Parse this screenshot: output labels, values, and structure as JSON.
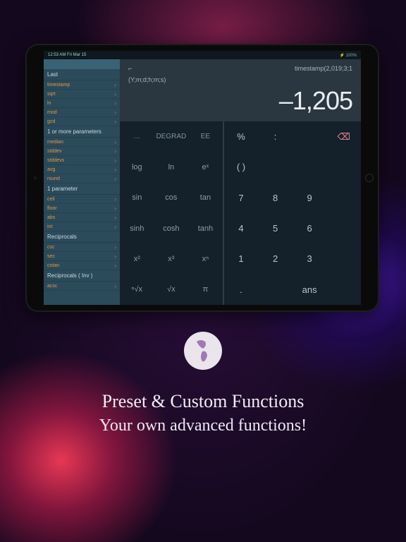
{
  "status": {
    "left": "12:53 AM  Fri Mar 15",
    "right": "⚡ 100%"
  },
  "sidebar": {
    "groups": [
      {
        "title": "Last",
        "items": [
          "timestamp",
          "sqrt",
          "ln",
          "mod",
          "gcd"
        ]
      },
      {
        "title": "1 or more parameters",
        "items": [
          "median",
          "stddev",
          "stddevs",
          "avg",
          "round"
        ]
      },
      {
        "title": "1 parameter",
        "items": [
          "ceil",
          "floor",
          "abs",
          "int"
        ]
      },
      {
        "title": "Reciprocals",
        "items": [
          "csc",
          "sec",
          "cotan"
        ]
      },
      {
        "title": "Reciprocals ( Inv )",
        "items": [
          "acsc"
        ]
      }
    ]
  },
  "display": {
    "cursor": "⌐",
    "expression": "timestamp(2,019;3;1",
    "signature": "(Y;m;d;h;m;s)",
    "result": "–1,205"
  },
  "keys": {
    "sci": [
      [
        "…",
        "DEGRAD",
        "EE"
      ],
      [
        "log",
        "ln",
        "eˣ"
      ],
      [
        "sin",
        "cos",
        "tan"
      ],
      [
        "sinh",
        "cosh",
        "tanh"
      ],
      [
        "x²",
        "x³",
        "xⁿ"
      ],
      [
        "ⁿ√x",
        "√x",
        "π"
      ]
    ],
    "num": [
      [
        "%",
        ":",
        "⌫"
      ],
      [
        "( )",
        "",
        ""
      ],
      [
        "7",
        "8",
        "9"
      ],
      [
        "4",
        "5",
        "6"
      ],
      [
        "1",
        "2",
        "3"
      ],
      [
        ".",
        "",
        "ans"
      ]
    ]
  },
  "promo": {
    "line1": "Preset & Custom Functions",
    "line2": "Your own advanced functions!"
  }
}
